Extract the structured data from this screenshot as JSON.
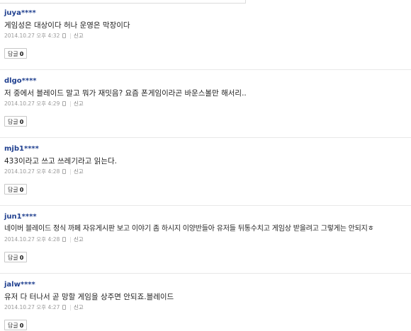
{
  "comments": [
    {
      "user": "juya****",
      "text": "게임성은 대상이다 허나 운영은 막장이다",
      "date": "2014.10.27 오후 4:32",
      "report": "신고",
      "reply_label": "답글",
      "reply_count": "0"
    },
    {
      "user": "dlgo****",
      "text": "저 중에서 블레이드 말고 뭐가 재밋음? 요즘 폰게임이라곤 바운스볼만 해서리..",
      "date": "2014.10.27 오후 4:29",
      "report": "신고",
      "reply_label": "답글",
      "reply_count": "0"
    },
    {
      "user": "mjb1****",
      "text": "433이라고 쓰고 쓰레기라고 읽는다.",
      "date": "2014.10.27 오후 4:28",
      "report": "신고",
      "reply_label": "답글",
      "reply_count": "0"
    },
    {
      "user": "jun1****",
      "text": "네이버 블레이드 정식 까페 자유게시판 보고 이야기 좀 하시지 이양반들아 유저들 뒤통수치고 게임상 받을려고 그렇게는 안되지ㅎ",
      "date": "2014.10.27 오후 4:28",
      "report": "신고",
      "reply_label": "답글",
      "reply_count": "0"
    },
    {
      "user": "jalw****",
      "text": "유저 다 터나서 곧 망할 게임을 상주면 안되죠.블레이드",
      "date": "2014.10.27 오후 4:27",
      "report": "신고",
      "reply_label": "답글",
      "reply_count": "0"
    }
  ]
}
